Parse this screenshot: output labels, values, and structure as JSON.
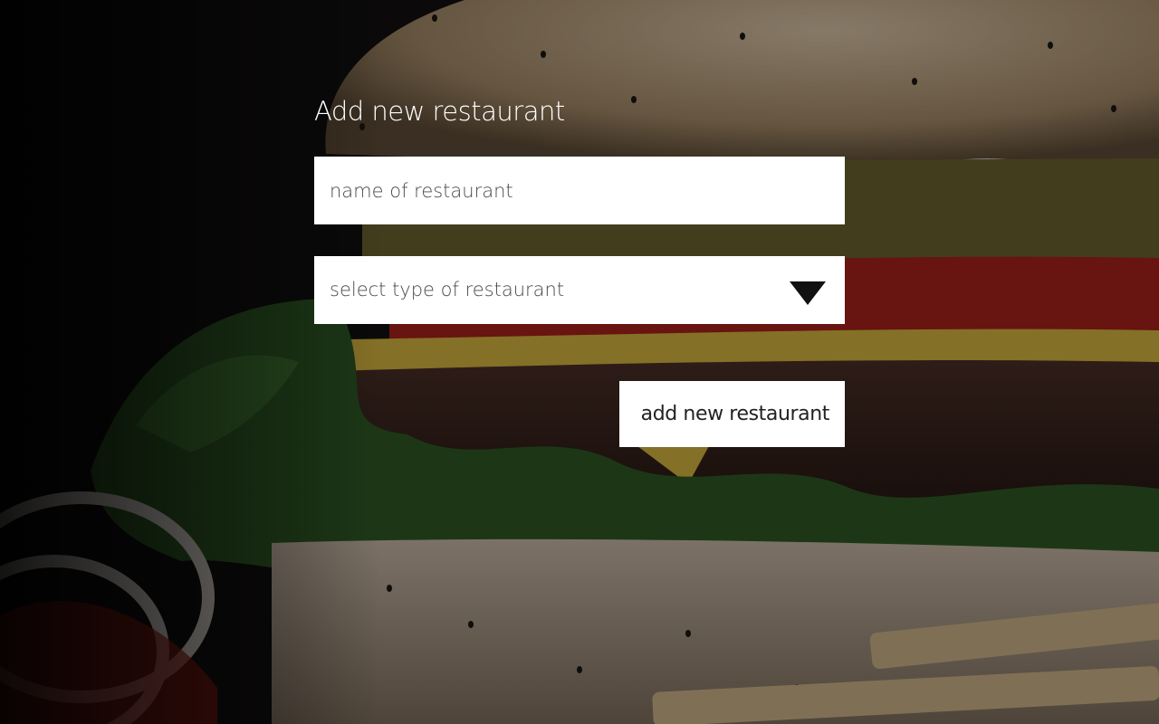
{
  "page": {
    "title": "Add new restaurant"
  },
  "form": {
    "name_input": {
      "value": "",
      "placeholder": "name of restaurant"
    },
    "type_select": {
      "selected_label": "select type of restaurant",
      "icon": "triangle-down-icon"
    },
    "submit_label": "add new restaurant"
  },
  "colors": {
    "field_background": "#ffffff",
    "title_text": "#ffffff",
    "overlay": "#000000"
  }
}
